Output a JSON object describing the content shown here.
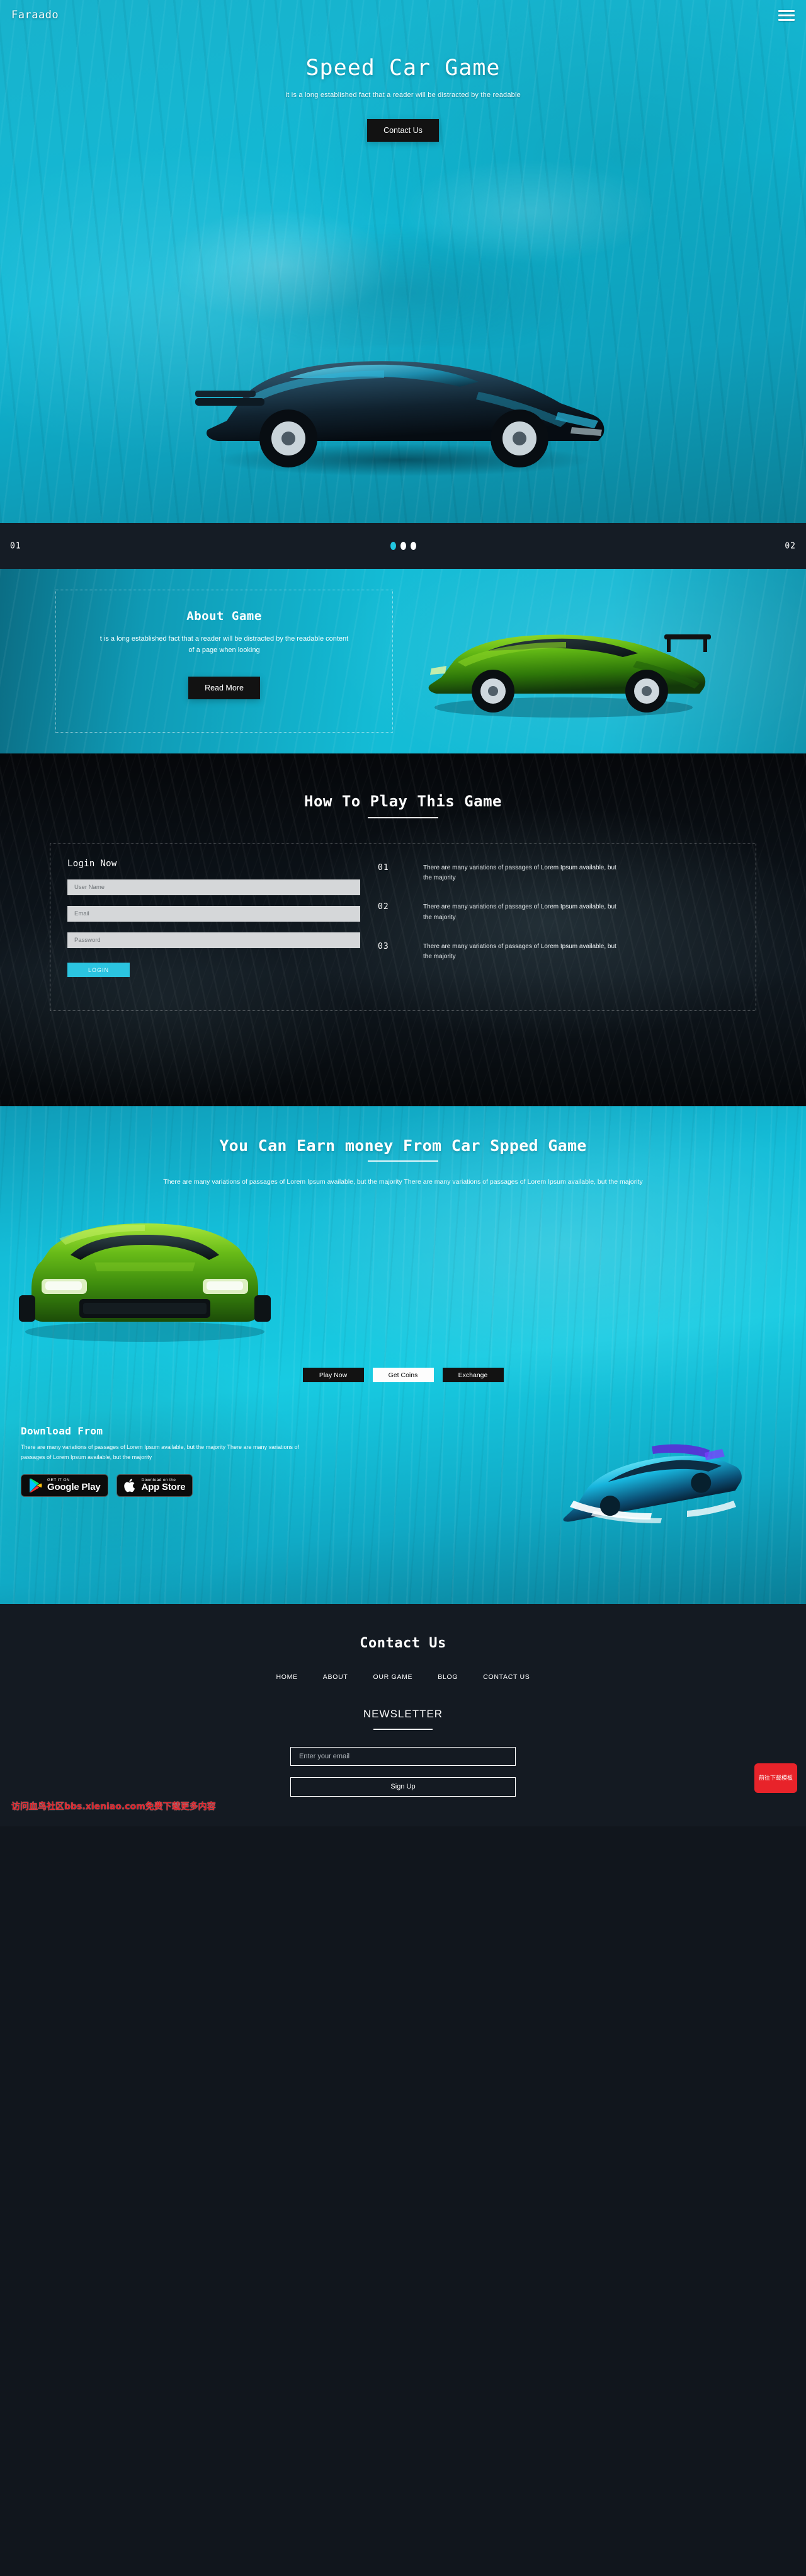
{
  "brand": {
    "logo": "Faraado",
    "accent": "#22c6e0",
    "dark": "#121212",
    "footer_bg": "#141a22"
  },
  "nav": {
    "menu_icon": "hamburger-icon"
  },
  "hero": {
    "title": "Speed Car Game",
    "subtitle": "It is a long established fact that a reader will be distracted by the readable",
    "cta": "Contact Us"
  },
  "carousel": {
    "left_index": "01",
    "right_index": "02",
    "dots": [
      {
        "active": true
      },
      {
        "active": false
      },
      {
        "active": false
      }
    ]
  },
  "about": {
    "title": "About Game",
    "text": "t is a long established fact that a reader will be distracted by the readable content of a page when looking",
    "button": "Read More"
  },
  "howto": {
    "heading": "How To Play This Game",
    "login": {
      "title": "Login Now",
      "fields": [
        {
          "name": "username",
          "placeholder": "User Name",
          "value": ""
        },
        {
          "name": "email",
          "placeholder": "Email",
          "value": ""
        },
        {
          "name": "password",
          "placeholder": "Password",
          "value": ""
        }
      ],
      "submit": "LOGIN"
    },
    "steps": [
      {
        "num": "01",
        "text": "There are many variations of passages of Lorem Ipsum available, but the majority"
      },
      {
        "num": "02",
        "text": "There are many variations of passages of Lorem Ipsum available, but the majority"
      },
      {
        "num": "03",
        "text": "There are many variations of passages of Lorem Ipsum available, but the majority"
      }
    ]
  },
  "earn": {
    "heading": "You Can Earn money From Car Spped Game",
    "paragraph": "There are many variations of passages of Lorem Ipsum available, but the majority There are many variations of passages of Lorem Ipsum available, but the majority",
    "buttons": [
      {
        "label": "Play Now",
        "style": "dark"
      },
      {
        "label": "Get Coins",
        "style": "light"
      },
      {
        "label": "Exchange",
        "style": "dark"
      }
    ]
  },
  "download": {
    "heading": "Download From",
    "text": "There are many variations of passages of Lorem Ipsum available, but the majority There are many variations of passages of Lorem Ipsum available, but the majority",
    "badges": [
      {
        "small": "GET IT ON",
        "big": "Google Play",
        "icon": "google-play-icon"
      },
      {
        "small": "Download on the",
        "big": "App Store",
        "icon": "apple-icon"
      }
    ]
  },
  "footer": {
    "heading": "Contact Us",
    "nav": [
      "HOME",
      "ABOUT",
      "OUR GAME",
      "BLOG",
      "CONTACT US"
    ],
    "newsletter_title": "NEWSLETTER",
    "email_placeholder": "Enter your email",
    "email_value": "",
    "signup": "Sign Up",
    "watermark": "访问血鸟社区bbs.xieniao.com免费下载更多内容",
    "float_button": "前往下载模板"
  }
}
